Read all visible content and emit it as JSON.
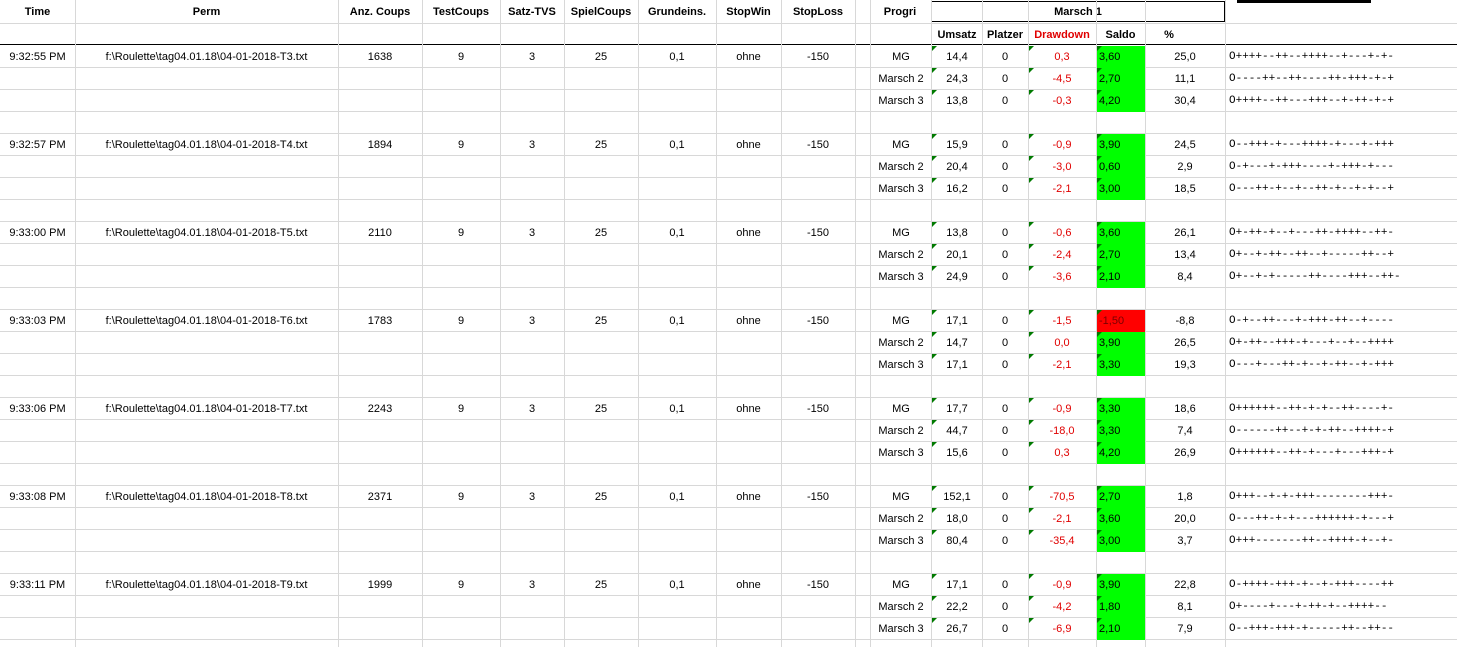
{
  "headers": {
    "time": "Time",
    "perm": "Perm",
    "anz_coups": "Anz. Coups",
    "test_coups": "TestCoups",
    "satz_tvs": "Satz-TVS",
    "spiel_coups": "SpielCoups",
    "grundeins": "Grundeins.",
    "stop_win": "StopWin",
    "stop_loss": "StopLoss",
    "progri": "Progri",
    "marsch_group": "Marsch 1",
    "umsatz": "Umsatz",
    "platzer": "Platzer",
    "drawdown": "Drawdown",
    "saldo": "Saldo",
    "percent": "%"
  },
  "colors": {
    "positive_saldo": "#00ff00",
    "negative_saldo": "#ff0000",
    "drawdown_text": "#e00000",
    "gridline": "#d8d8d8"
  },
  "groups": [
    {
      "time": "9:32:55 PM",
      "perm": "f:\\Roulette\\tag04.01.18\\04-01-2018-T3.txt",
      "anz_coups": "1638",
      "test_coups": "9",
      "satz_tvs": "3",
      "spiel_coups": "25",
      "grundeins": "0,1",
      "stop_win": "ohne",
      "stop_loss": "-150",
      "rows": [
        {
          "progri": "MG",
          "umsatz": "14,4",
          "platzer": "0",
          "drawdown": "0,3",
          "saldo": "3,60",
          "saldo_state": "positive",
          "pct": "25,0",
          "seq": "O++++--++--++++--+---+-+-"
        },
        {
          "progri": "Marsch 2",
          "umsatz": "24,3",
          "platzer": "0",
          "drawdown": "-4,5",
          "saldo": "2,70",
          "saldo_state": "positive",
          "pct": "11,1",
          "seq": "O----++--++----++-+++-+-+"
        },
        {
          "progri": "Marsch 3",
          "umsatz": "13,8",
          "platzer": "0",
          "drawdown": "-0,3",
          "saldo": "4,20",
          "saldo_state": "positive",
          "pct": "30,4",
          "seq": "O++++--++---+++--+-++-+-+"
        }
      ]
    },
    {
      "time": "9:32:57 PM",
      "perm": "f:\\Roulette\\tag04.01.18\\04-01-2018-T4.txt",
      "anz_coups": "1894",
      "test_coups": "9",
      "satz_tvs": "3",
      "spiel_coups": "25",
      "grundeins": "0,1",
      "stop_win": "ohne",
      "stop_loss": "-150",
      "rows": [
        {
          "progri": "MG",
          "umsatz": "15,9",
          "platzer": "0",
          "drawdown": "-0,9",
          "saldo": "3,90",
          "saldo_state": "positive",
          "pct": "24,5",
          "seq": "O--+++-+---++++-+---+-+++"
        },
        {
          "progri": "Marsch 2",
          "umsatz": "20,4",
          "platzer": "0",
          "drawdown": "-3,0",
          "saldo": "0,60",
          "saldo_state": "positive",
          "pct": "2,9",
          "seq": "O-+---+-+++----+-+++-+---"
        },
        {
          "progri": "Marsch 3",
          "umsatz": "16,2",
          "platzer": "0",
          "drawdown": "-2,1",
          "saldo": "3,00",
          "saldo_state": "positive",
          "pct": "18,5",
          "seq": "O---++-+--+--++-+--+-+--+"
        }
      ]
    },
    {
      "time": "9:33:00 PM",
      "perm": "f:\\Roulette\\tag04.01.18\\04-01-2018-T5.txt",
      "anz_coups": "2110",
      "test_coups": "9",
      "satz_tvs": "3",
      "spiel_coups": "25",
      "grundeins": "0,1",
      "stop_win": "ohne",
      "stop_loss": "-150",
      "rows": [
        {
          "progri": "MG",
          "umsatz": "13,8",
          "platzer": "0",
          "drawdown": "-0,6",
          "saldo": "3,60",
          "saldo_state": "positive",
          "pct": "26,1",
          "seq": "O+-++-+--+---++-++++--++-"
        },
        {
          "progri": "Marsch 2",
          "umsatz": "20,1",
          "platzer": "0",
          "drawdown": "-2,4",
          "saldo": "2,70",
          "saldo_state": "positive",
          "pct": "13,4",
          "seq": "O+--+-++--++--+-----++--+"
        },
        {
          "progri": "Marsch 3",
          "umsatz": "24,9",
          "platzer": "0",
          "drawdown": "-3,6",
          "saldo": "2,10",
          "saldo_state": "positive",
          "pct": "8,4",
          "seq": "O+--+-+-----++----+++--++-"
        }
      ]
    },
    {
      "time": "9:33:03 PM",
      "perm": "f:\\Roulette\\tag04.01.18\\04-01-2018-T6.txt",
      "anz_coups": "1783",
      "test_coups": "9",
      "satz_tvs": "3",
      "spiel_coups": "25",
      "grundeins": "0,1",
      "stop_win": "ohne",
      "stop_loss": "-150",
      "rows": [
        {
          "progri": "MG",
          "umsatz": "17,1",
          "platzer": "0",
          "drawdown": "-1,5",
          "saldo": "-1,50",
          "saldo_state": "negative",
          "pct": "-8,8",
          "seq": "O-+--++---+-+++-++--+----"
        },
        {
          "progri": "Marsch 2",
          "umsatz": "14,7",
          "platzer": "0",
          "drawdown": "0,0",
          "saldo": "3,90",
          "saldo_state": "positive",
          "pct": "26,5",
          "seq": "O+-++--+++-+---+--+--++++"
        },
        {
          "progri": "Marsch 3",
          "umsatz": "17,1",
          "platzer": "0",
          "drawdown": "-2,1",
          "saldo": "3,30",
          "saldo_state": "positive",
          "pct": "19,3",
          "seq": "O---+---++-+--+-++--+-+++"
        }
      ]
    },
    {
      "time": "9:33:06 PM",
      "perm": "f:\\Roulette\\tag04.01.18\\04-01-2018-T7.txt",
      "anz_coups": "2243",
      "test_coups": "9",
      "satz_tvs": "3",
      "spiel_coups": "25",
      "grundeins": "0,1",
      "stop_win": "ohne",
      "stop_loss": "-150",
      "rows": [
        {
          "progri": "MG",
          "umsatz": "17,7",
          "platzer": "0",
          "drawdown": "-0,9",
          "saldo": "3,30",
          "saldo_state": "positive",
          "pct": "18,6",
          "seq": "O++++++--++-+-+--++----+-"
        },
        {
          "progri": "Marsch 2",
          "umsatz": "44,7",
          "platzer": "0",
          "drawdown": "-18,0",
          "saldo": "3,30",
          "saldo_state": "positive",
          "pct": "7,4",
          "seq": "O------++--+-+-++--++++-+"
        },
        {
          "progri": "Marsch 3",
          "umsatz": "15,6",
          "platzer": "0",
          "drawdown": "0,3",
          "saldo": "4,20",
          "saldo_state": "positive",
          "pct": "26,9",
          "seq": "O++++++--++-+---+---+++-+"
        }
      ]
    },
    {
      "time": "9:33:08 PM",
      "perm": "f:\\Roulette\\tag04.01.18\\04-01-2018-T8.txt",
      "anz_coups": "2371",
      "test_coups": "9",
      "satz_tvs": "3",
      "spiel_coups": "25",
      "grundeins": "0,1",
      "stop_win": "ohne",
      "stop_loss": "-150",
      "rows": [
        {
          "progri": "MG",
          "umsatz": "152,1",
          "platzer": "0",
          "drawdown": "-70,5",
          "saldo": "2,70",
          "saldo_state": "positive",
          "pct": "1,8",
          "seq": "O+++--+-+-+++--------+++-"
        },
        {
          "progri": "Marsch 2",
          "umsatz": "18,0",
          "platzer": "0",
          "drawdown": "-2,1",
          "saldo": "3,60",
          "saldo_state": "positive",
          "pct": "20,0",
          "seq": "O---++-+-+---++++++-+---+"
        },
        {
          "progri": "Marsch 3",
          "umsatz": "80,4",
          "platzer": "0",
          "drawdown": "-35,4",
          "saldo": "3,00",
          "saldo_state": "positive",
          "pct": "3,7",
          "seq": "O+++-------++--++++-+--+-"
        }
      ]
    },
    {
      "time": "9:33:11 PM",
      "perm": "f:\\Roulette\\tag04.01.18\\04-01-2018-T9.txt",
      "anz_coups": "1999",
      "test_coups": "9",
      "satz_tvs": "3",
      "spiel_coups": "25",
      "grundeins": "0,1",
      "stop_win": "ohne",
      "stop_loss": "-150",
      "rows": [
        {
          "progri": "MG",
          "umsatz": "17,1",
          "platzer": "0",
          "drawdown": "-0,9",
          "saldo": "3,90",
          "saldo_state": "positive",
          "pct": "22,8",
          "seq": "O-++++-+++-+--+-+++----++"
        },
        {
          "progri": "Marsch 2",
          "umsatz": "22,2",
          "platzer": "0",
          "drawdown": "-4,2",
          "saldo": "1,80",
          "saldo_state": "positive",
          "pct": "8,1",
          "seq": "O+----+---+-++-+--++++--"
        },
        {
          "progri": "Marsch 3",
          "umsatz": "26,7",
          "platzer": "0",
          "drawdown": "-6,9",
          "saldo": "2,10",
          "saldo_state": "positive",
          "pct": "7,9",
          "seq": "O--+++-+++-+-----++--++--"
        }
      ]
    }
  ]
}
